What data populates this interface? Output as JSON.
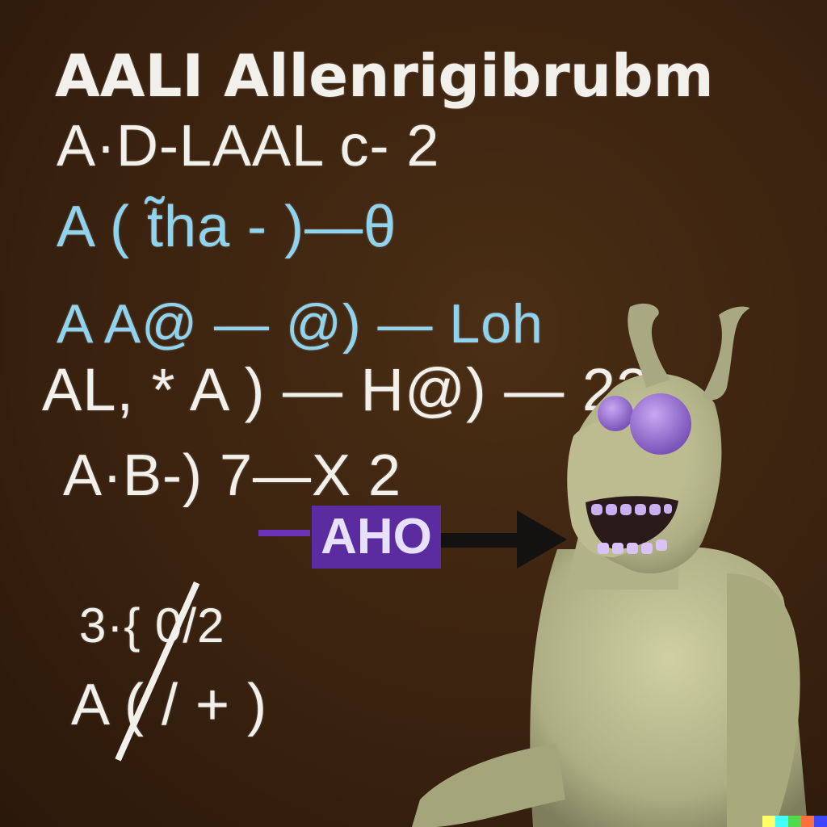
{
  "board": {
    "title": "AALI Allenrigibrubm",
    "lines": [
      "A·D-LAAL c- 2",
      "A ( t̃ha - )—θ",
      "A   A@ — @) — Loh",
      "AL, *  A ) — H@) — 22",
      "A·B-)     7—X   2",
      "3·{ 0/2",
      "A ( / + )"
    ],
    "label_box_text": "AHO"
  },
  "colors": {
    "chalkboard": "#3a220f",
    "chalk_white": "#f2f0ea",
    "chalk_cyan": "#8fd3ee",
    "label_purple": "#5a2ca0",
    "creature_skin": "#b9b98e",
    "eye_purple": "#a07ad6"
  },
  "watermark": {
    "colors": [
      "#ffff66",
      "#42ffff",
      "#51da4c",
      "#ff6e3c",
      "#3c46ff"
    ]
  }
}
